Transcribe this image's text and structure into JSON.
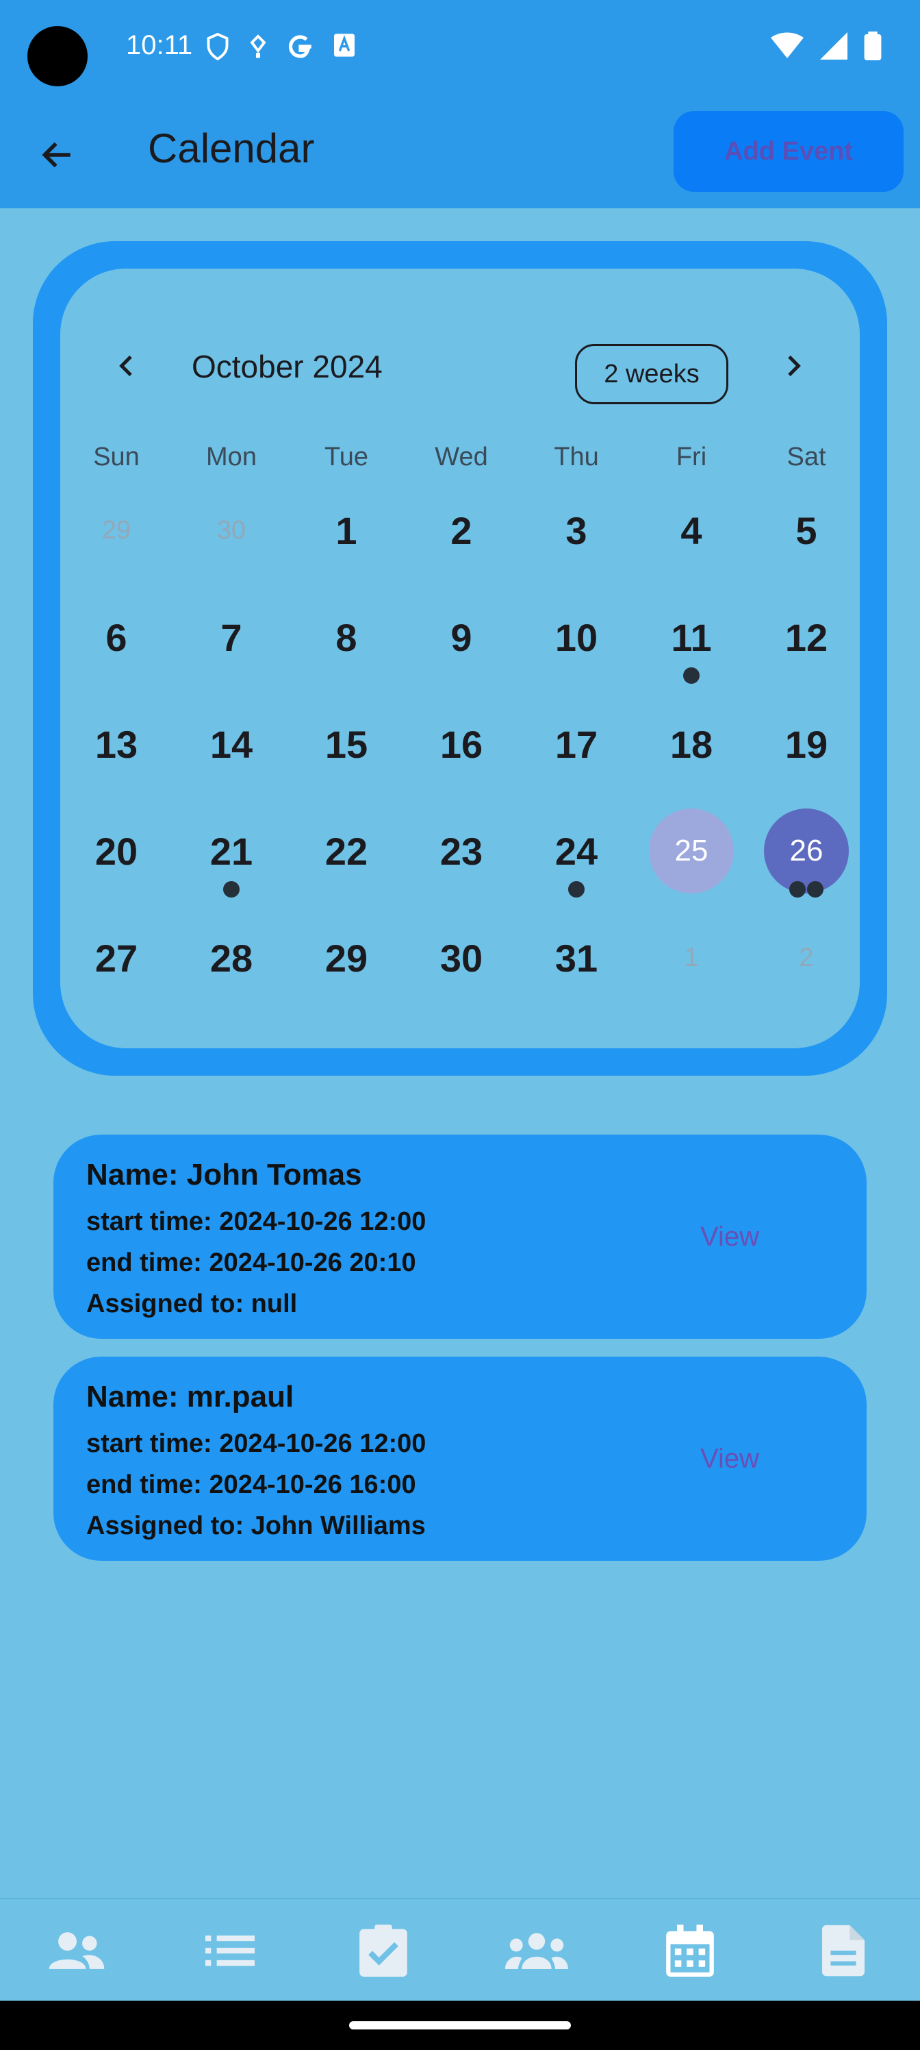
{
  "status_bar": {
    "time": "10:11",
    "left_icons": [
      "shield-icon",
      "pin-icon",
      "google-icon",
      "font-icon"
    ],
    "right_icons": [
      "wifi-icon",
      "signal-icon",
      "battery-icon"
    ]
  },
  "app_bar": {
    "title": "Calendar",
    "add_event_label": "Add Event",
    "back_icon": "arrow-back-icon"
  },
  "calendar": {
    "month_label": "October 2024",
    "format_label": "2 weeks",
    "weekdays": [
      "Sun",
      "Mon",
      "Tue",
      "Wed",
      "Thu",
      "Fri",
      "Sat"
    ],
    "weeks": [
      [
        "29",
        "30",
        "1",
        "2",
        "3",
        "4",
        "5"
      ],
      [
        "6",
        "7",
        "8",
        "9",
        "10",
        "11",
        "12"
      ],
      [
        "13",
        "14",
        "15",
        "16",
        "17",
        "18",
        "19"
      ],
      [
        "20",
        "21",
        "22",
        "23",
        "24",
        "25",
        "26"
      ],
      [
        "27",
        "28",
        "29",
        "30",
        "31",
        "1",
        "2"
      ]
    ],
    "today": "25",
    "selected": "26",
    "event_markers": {
      "11": 1,
      "21": 1,
      "24": 1,
      "26": 2
    },
    "colors": {
      "today": "#9da9dd",
      "selected": "#5c6bc0",
      "marker": "#26303a"
    }
  },
  "events": [
    {
      "name": "Name: John Tomas",
      "start": "start time: 2024-10-26 12:00",
      "end": "end time: 2024-10-26 20:10",
      "assigned": "Assigned to: null",
      "view_label": "View"
    },
    {
      "name": "Name: mr.paul",
      "start": "start time: 2024-10-26 12:00",
      "end": "end time: 2024-10-26 16:00",
      "assigned": "Assigned to: John Williams",
      "view_label": "View"
    }
  ],
  "bottom_nav": {
    "items": [
      "people-icon",
      "list-icon",
      "assignment-icon",
      "groups-icon",
      "calendar-icon",
      "document-icon"
    ],
    "active": "calendar-icon"
  }
}
